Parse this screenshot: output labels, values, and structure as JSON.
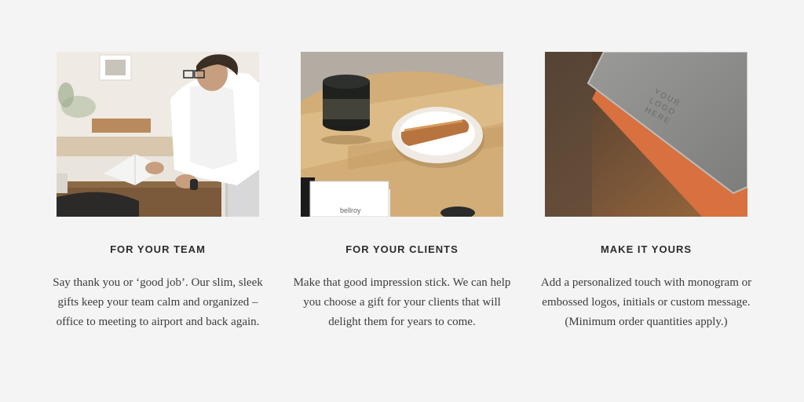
{
  "features": [
    {
      "title": "FOR YOUR TEAM",
      "description": "Say thank you or ‘good job’. Our slim, sleek gifts keep your team calm and organized – office to meeting to airport and back again.",
      "image_label": "person writing in notebook at desk"
    },
    {
      "title": "FOR YOUR CLIENTS",
      "description": "Make that good impression stick. We can help you choose a gift for your clients that will delight them for years to come.",
      "image_label": "leather key cover in dish beside coffee cup",
      "notebook_brand": "bellroy"
    },
    {
      "title": "MAKE IT YOURS",
      "description": "Add a personalized touch with monogram or embossed logos, initials or custom message. (Minimum order quantities apply.)",
      "image_label": "leather sleeve with embossed logo",
      "emboss_lines": [
        "YOUR",
        "LOGO",
        "HERE"
      ]
    }
  ],
  "colors": {
    "background": "#f4f4f4",
    "heading": "#2b2b2b",
    "body_text": "#3c3c3c",
    "leather_tan": "#b8743f",
    "leather_orange": "#d9703f"
  }
}
